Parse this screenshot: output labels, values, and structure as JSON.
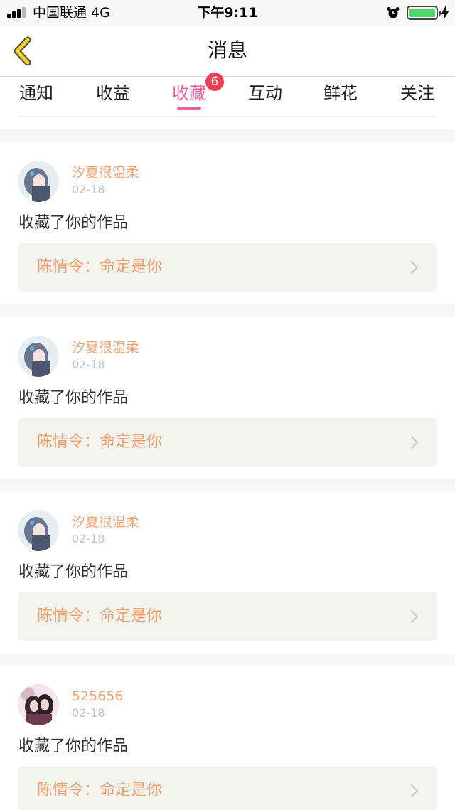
{
  "status_bar": {
    "carrier": "中国联通   4G",
    "time": "下午9:11",
    "battery_level": 1.0
  },
  "nav": {
    "title": "消息",
    "back_icon": "chevron-left-icon"
  },
  "tabs": [
    {
      "label": "通知"
    },
    {
      "label": "收益"
    },
    {
      "label": "收藏"
    },
    {
      "label": "互动"
    },
    {
      "label": "鲜花"
    },
    {
      "label": "关注"
    }
  ],
  "active_tab_badge": "6",
  "colors": {
    "accent": "#e8629a",
    "badge": "#ef3f55",
    "username": "#f0a173",
    "work_box": "#f4f4ee"
  },
  "feed": [
    {
      "user": "汐夏很温柔",
      "date": "02-18",
      "action": "收藏了你的作品",
      "work": "陈情令：命定是你"
    },
    {
      "user": "汐夏很温柔",
      "date": "02-18",
      "action": "收藏了你的作品",
      "work": "陈情令：命定是你"
    },
    {
      "user": "汐夏很温柔",
      "date": "02-18",
      "action": "收藏了你的作品",
      "work": "陈情令：命定是你"
    },
    {
      "user": "525656",
      "date": "02-18",
      "action": "收藏了你的作品",
      "work": "陈情令：命定是你"
    }
  ]
}
